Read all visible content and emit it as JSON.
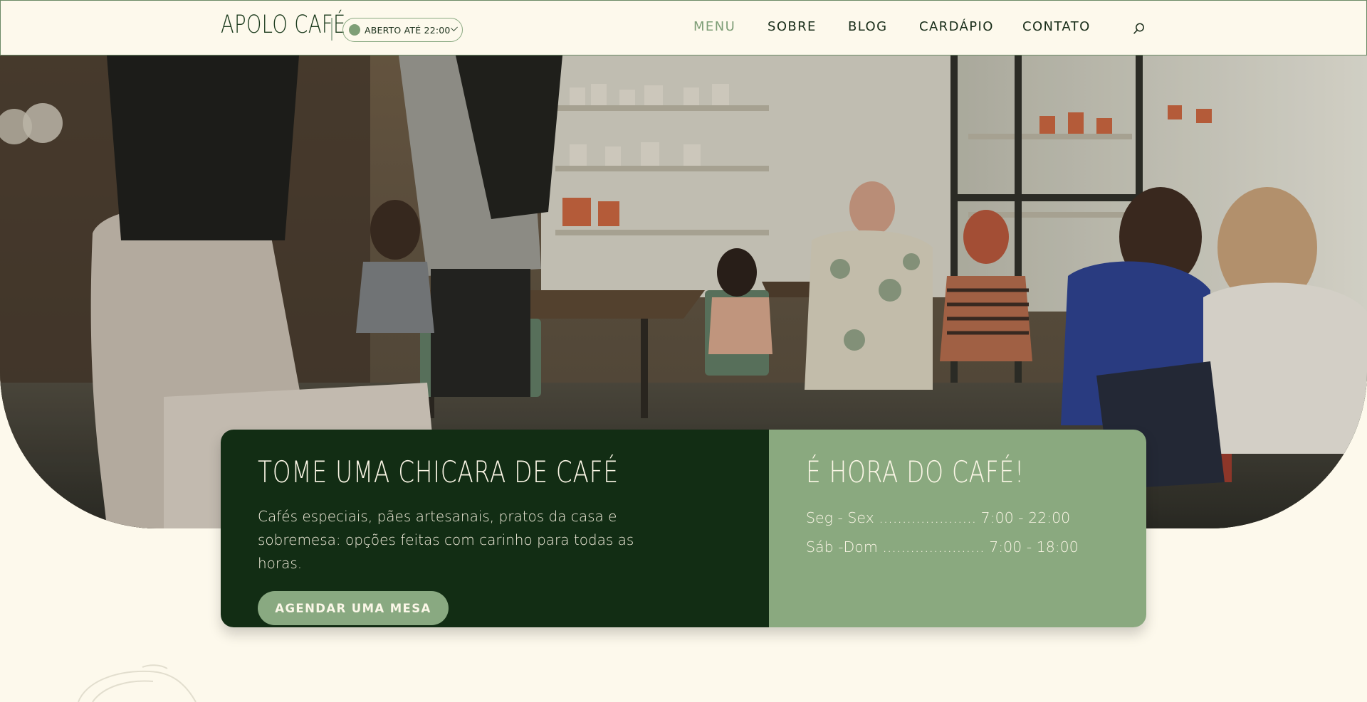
{
  "header": {
    "logo": "APOLO CAFÉ",
    "status": {
      "label": "ABERTO ATÉ 22:00"
    },
    "nav": [
      "MENU",
      "SOBRE",
      "BLOG",
      "CARDÁPIO",
      "CONTATO"
    ],
    "active_nav": "MENU"
  },
  "hero": {
    "image": "cafe-interior-photo"
  },
  "card": {
    "left": {
      "title": "TOME UMA CHICARA DE CAFÉ",
      "description": "Cafés especiais, pães artesanais, pratos da casa e sobremesa: opções feitas com carinho para todas as horas.",
      "button": "AGENDAR UMA MESA"
    },
    "right": {
      "title": "É HORA DO CAFÉ!",
      "hours": [
        "Seg - Sex ..................... 7:00 - 22:00",
        "Sáb -Dom ...................... 7:00 - 18:00"
      ]
    }
  },
  "colors": {
    "background": "#fdf9ec",
    "dark_green": "#122d14",
    "sage_green": "#8aa97f",
    "accent": "#7e9e77"
  }
}
